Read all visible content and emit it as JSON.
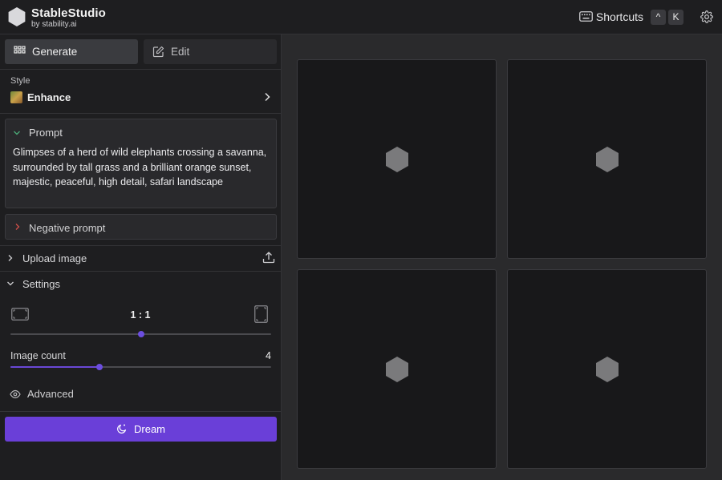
{
  "app": {
    "name": "StableStudio",
    "byline": "by stability.ai"
  },
  "topbar": {
    "shortcuts_label": "Shortcuts",
    "shortcut_keys": [
      "^",
      "K"
    ]
  },
  "sidebar": {
    "tabs": [
      {
        "label": "Generate",
        "icon": "grid-icon",
        "active": true
      },
      {
        "label": "Edit",
        "icon": "edit-icon",
        "active": false
      }
    ],
    "style": {
      "label": "Style",
      "value": "Enhance"
    },
    "prompt": {
      "title": "Prompt",
      "text": "Glimpses of a herd of wild elephants crossing a savanna, surrounded by tall grass and a brilliant orange sunset, majestic, peaceful, high detail, safari landscape"
    },
    "negative_prompt": {
      "title": "Negative prompt"
    },
    "upload_image": {
      "label": "Upload image"
    },
    "settings": {
      "label": "Settings",
      "aspect_ratio": "1 : 1",
      "aspect_ratio_slider_fraction": 0.5,
      "image_count_label": "Image count",
      "image_count": "4",
      "image_count_slider_fraction": 0.34
    },
    "advanced": {
      "label": "Advanced"
    },
    "dream_button": {
      "label": "Dream"
    }
  },
  "main": {
    "placeholder_count": 4
  },
  "colors": {
    "accent": "#6a3fd8",
    "background": "#1e1e20",
    "canvas": "#2a2a2c",
    "placeholder_hex": "#7a7a7c"
  }
}
